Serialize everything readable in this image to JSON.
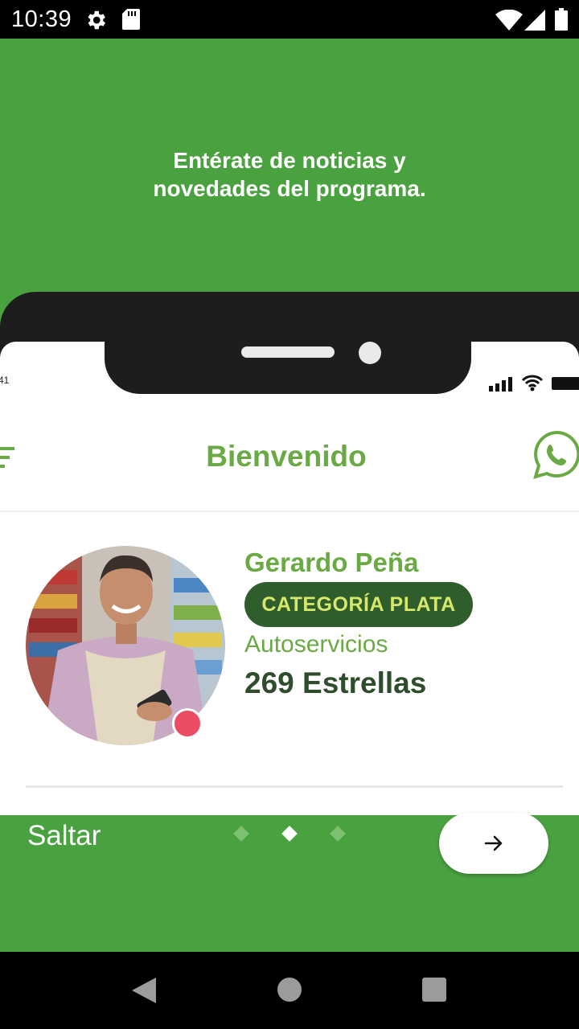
{
  "status_bar": {
    "time": "10:39"
  },
  "onboarding": {
    "headline_line1": "Entérate de noticias y",
    "headline_line2": "novedades del programa.",
    "skip_label": "Saltar",
    "page_count": 3,
    "current_page": 2
  },
  "phone_mockup": {
    "mini_time": "41",
    "app_title": "Bienvenido",
    "user": {
      "name": "Gerardo Peña",
      "category": "CATEGORÍA PLATA",
      "segment": "Autoservicios",
      "stars": "269 Estrellas"
    }
  },
  "colors": {
    "brand_green": "#49a13f",
    "title_green": "#6aaa45",
    "category_bg": "#2f5d2c",
    "category_text": "#d5e86b",
    "badge_red": "#ea4c63"
  },
  "icons": {
    "settings": "gear-icon",
    "sd_card": "sd-card-icon",
    "wifi": "wifi-icon",
    "signal": "signal-icon",
    "battery": "battery-icon",
    "menu": "menu-icon",
    "whatsapp": "whatsapp-icon",
    "next": "arrow-right-icon",
    "back": "back-triangle-icon",
    "home": "home-circle-icon",
    "recents": "recents-square-icon"
  }
}
